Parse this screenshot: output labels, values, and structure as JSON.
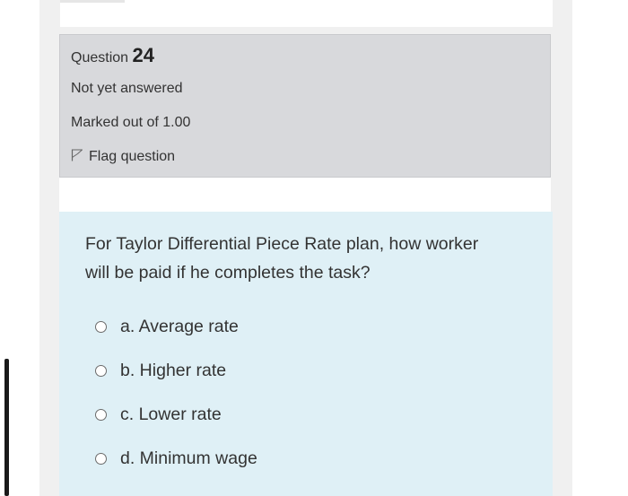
{
  "question_info": {
    "question_word": "Question",
    "question_number": "24",
    "status": "Not yet answered",
    "marks": "Marked out of 1.00",
    "flag_label": "Flag question",
    "flag_icon": "flag-outline-icon"
  },
  "question": {
    "text_line1": "For Taylor Differential Piece Rate plan, how worker",
    "text_line2": "will be paid if he completes the task?",
    "options": [
      {
        "label": "a. Average rate",
        "selected": false
      },
      {
        "label": "b. Higher rate",
        "selected": false
      },
      {
        "label": "c. Lower rate",
        "selected": false
      },
      {
        "label": "d. Minimum wage",
        "selected": false
      }
    ]
  },
  "colors": {
    "info_background": "#d8d9dc",
    "content_background": "#dff0f6",
    "text": "#333333"
  }
}
